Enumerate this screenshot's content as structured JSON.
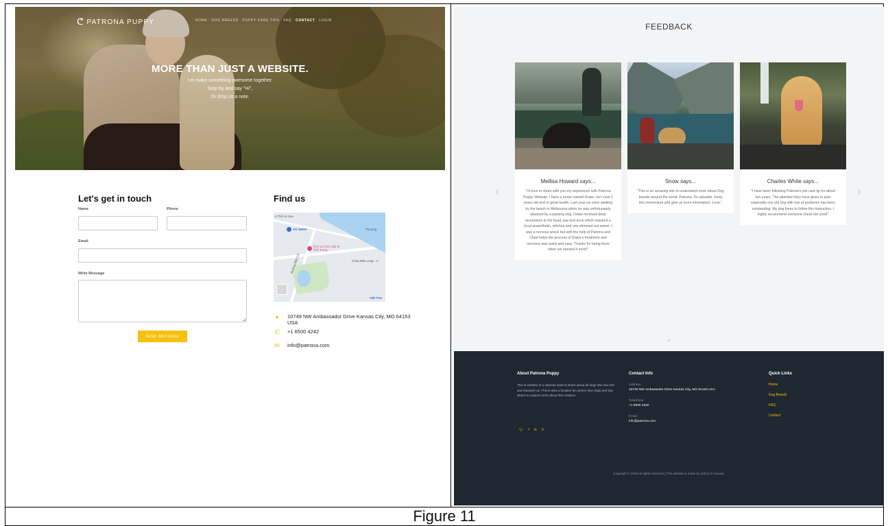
{
  "figure": {
    "caption": "Figure 11"
  },
  "contact_page": {
    "brand": "PATRONA PUPPY",
    "nav": [
      "HOME",
      "DOG BREEDS",
      "PUPPY CARE TIPS",
      "FAQ",
      "CONTACT",
      "LOGIN"
    ],
    "active_nav": "CONTACT",
    "hero_title": "MORE THAN JUST A WEBSITE.",
    "hero_lines": [
      "Let make something awesome together.",
      "Stop by and say \"Hi\",",
      "Or drop us a note."
    ],
    "form": {
      "title": "Let's get in touch",
      "name_label": "Name",
      "phone_label": "Phone",
      "email_label": "Email",
      "message_label": "Write Message",
      "submit_label": "SEND MESSAGE"
    },
    "find_us": {
      "title": "Find us",
      "map_labels": [
        "a Thê An Sao",
        "YG SHOP",
        "Kho vui chơi giải trí Thế Trang",
        "Chùa Đầu Long - C",
        "Việt Thư",
        "Thượng",
        "Đường Bắc Cổ"
      ],
      "address": "10749 NW Ambassador Drive Kansas City, MO 64153 USA",
      "phone": "+1 6500 4242",
      "email": "info@patrona.com"
    }
  },
  "feedback_page": {
    "title": "FEEDBACK",
    "cards": [
      {
        "name": "Mellisa Howard",
        "says": "says...",
        "text": "\"I'd love to share with you my experience with Patrona Puppy Website. I have a boxer named Drake, he's now 2 years old and in great health. Last year we were walking by the beach in Melbourne when he was unfortunately attacked by a passing dog. Drake received deep lacerations to his head, jaw and neck which required a local anaesthetic, stitches and one stressed out owner. I was a nervous wreck but with the help of Patrona and Chad helps the process of Drake's treatment and recovery was quick and easy. Thanks for being there when we needed it most!\""
      },
      {
        "name": "Snow",
        "says": "says...",
        "text": "\"This is an amazing site to understand more about Dog breeds around the world. Patrona, it's valuable. Keep this momentum and give us more information. Love.\""
      },
      {
        "name": "Charles White",
        "says": "says...",
        "text": "\"I have been following Patrona's pet care tip for about two years. The attention they have given to pets especially one old dog with lots of problems has been outstanding. My dog loves to follow this instruction. I highly recommend everyone check her post!\""
      }
    ],
    "prev_arrow": "‹",
    "next_arrow": "›",
    "footer": {
      "about_title": "About Patrona Puppy",
      "about_text": "This is website of a veterian want to share about all dogs she has met and research us. This is also a location for person love dogs and has desire to explore more about this creature.",
      "social": [
        "twitter-icon",
        "facebook-icon",
        "linkedin-icon",
        "pinterest-icon"
      ],
      "contact_title": "Contact Info",
      "address_label": "Address:",
      "address": "10749 NW Ambassador Drive Kansas City, MO 64153 USA",
      "telephone_label": "Telephone:",
      "telephone": "+1 6500 4242",
      "email_label": "Email:",
      "email": "info@patrona.com",
      "links_title": "Quick Links",
      "links": [
        "Home",
        "Dog Breeds",
        "FAQ",
        "Contact"
      ],
      "copyright": "Copyright © 2020 All rights reserved  |  This website is made by 20021.D Group4."
    }
  },
  "colors": {
    "accent": "#f5c10e",
    "footer_bg": "#1f2730",
    "page_bg": "#f3f4f6"
  }
}
